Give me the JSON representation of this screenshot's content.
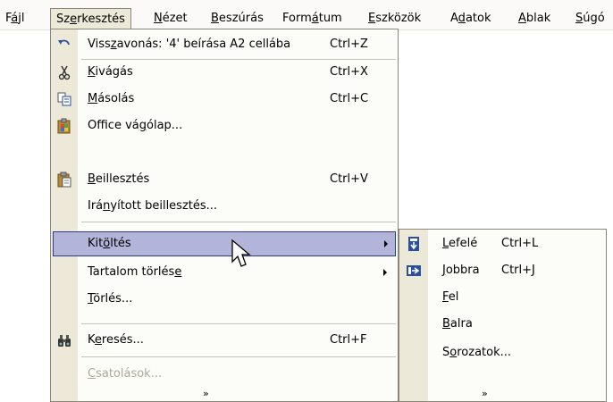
{
  "menubar": {
    "items": [
      {
        "pre": "F",
        "key": "á",
        "post": "jl"
      },
      {
        "pre": "Sz",
        "key": "e",
        "post": "rkesztés"
      },
      {
        "pre": "",
        "key": "N",
        "post": "ézet"
      },
      {
        "pre": "",
        "key": "B",
        "post": "eszúrás"
      },
      {
        "pre": "Form",
        "key": "á",
        "post": "tum"
      },
      {
        "pre": "",
        "key": "E",
        "post": "szközök"
      },
      {
        "pre": "A",
        "key": "d",
        "post": "atok"
      },
      {
        "pre": "",
        "key": "A",
        "post": "blak"
      },
      {
        "pre": "",
        "key": "S",
        "post": "úgó"
      }
    ]
  },
  "edit_menu": {
    "items": [
      {
        "pre": "Viss",
        "key": "z",
        "post": "avonás: '4' beírása A2 cellába",
        "shortcut": "Ctrl+Z",
        "icon": "undo-icon"
      },
      {
        "pre": "",
        "key": "K",
        "post": "ivágás",
        "shortcut": "Ctrl+X",
        "icon": "scissors-icon"
      },
      {
        "pre": "",
        "key": "M",
        "post": "ásolás",
        "shortcut": "Ctrl+C",
        "icon": "copy-icon"
      },
      {
        "pre": "Office vá",
        "key": "g",
        "post": "ólap...",
        "shortcut": "",
        "icon": "clipboard-icon"
      },
      {
        "pre": "",
        "key": "B",
        "post": "eillesztés",
        "shortcut": "Ctrl+V",
        "icon": "paste-icon"
      },
      {
        "pre": "Irá",
        "key": "n",
        "post": "yított beillesztés...",
        "shortcut": "",
        "icon": ""
      },
      {
        "pre": "Kit",
        "key": "ö",
        "post": "ltés",
        "shortcut": "",
        "icon": ""
      },
      {
        "pre": "Tartalom törlés",
        "key": "e",
        "post": "",
        "shortcut": "",
        "icon": ""
      },
      {
        "pre": "",
        "key": "T",
        "post": "örlés...",
        "shortcut": "",
        "icon": ""
      },
      {
        "pre": "K",
        "key": "e",
        "post": "resés...",
        "shortcut": "Ctrl+F",
        "icon": "binoculars-icon"
      },
      {
        "pre": "",
        "key": "C",
        "post": "satolások...",
        "shortcut": "",
        "icon": ""
      }
    ],
    "more": "»"
  },
  "fill_submenu": {
    "items": [
      {
        "pre": "",
        "key": "L",
        "post": "efelé",
        "shortcut": "Ctrl+L",
        "icon": "fill-down-icon"
      },
      {
        "pre": "",
        "key": "J",
        "post": "obbra",
        "shortcut": "Ctrl+J",
        "icon": "fill-right-icon"
      },
      {
        "pre": "",
        "key": "F",
        "post": "el",
        "shortcut": "",
        "icon": ""
      },
      {
        "pre": "",
        "key": "B",
        "post": "alra",
        "shortcut": "",
        "icon": ""
      },
      {
        "pre": "S",
        "key": "o",
        "post": "rozatok...",
        "shortcut": "",
        "icon": ""
      }
    ],
    "more": "»"
  },
  "colors": {
    "highlight": "#b2b4d9",
    "highlight_border": "#2f3a8a",
    "gutter": "#ece9d8",
    "disabled": "#aca899"
  }
}
